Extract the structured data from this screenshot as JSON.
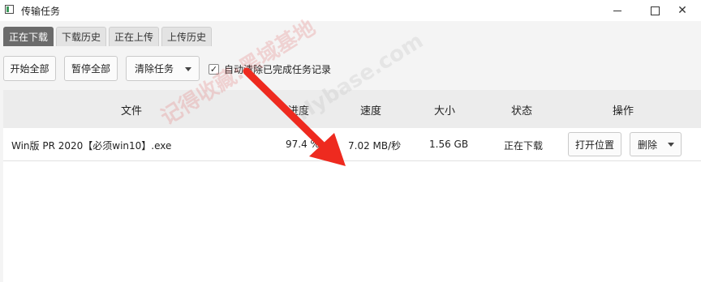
{
  "window": {
    "title": "传输任务",
    "close_glyph": "✕"
  },
  "tabs": [
    {
      "label": "正在下载",
      "active": true
    },
    {
      "label": "下载历史",
      "active": false
    },
    {
      "label": "正在上传",
      "active": false
    },
    {
      "label": "上传历史",
      "active": false
    }
  ],
  "toolbar": {
    "start_all": "开始全部",
    "pause_all": "暂停全部",
    "clear_tasks": "清除任务",
    "auto_clear_label": "自动清除已完成任务记录",
    "auto_clear_checked": true,
    "check_glyph": "✓"
  },
  "table": {
    "headers": {
      "file": "文件",
      "progress": "进度",
      "speed": "速度",
      "size": "大小",
      "status": "状态",
      "actions": "操作"
    },
    "rows": [
      {
        "file": "Win版 PR 2020【必须win10】.exe",
        "progress": "97.4 %",
        "speed": "7.02 MB/秒",
        "size": "1.56 GB",
        "status": "正在下载",
        "open_location": "打开位置",
        "delete": "删除"
      }
    ]
  },
  "overlay": {
    "watermark": "记得收藏:黑域基地",
    "watermark_site": "Hybase.com",
    "arrow_color": "#ee2a1f"
  }
}
